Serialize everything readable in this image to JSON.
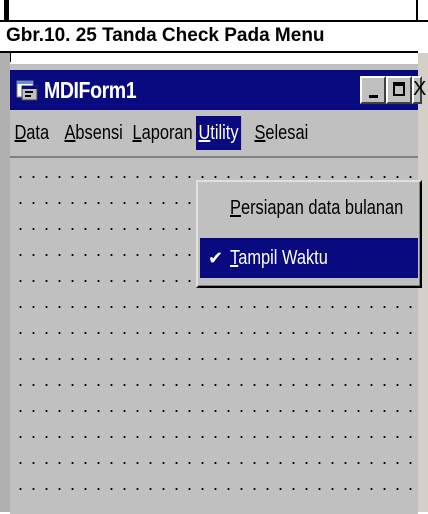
{
  "caption": "Gbr.10. 25 Tanda Check Pada Menu",
  "window": {
    "title": "MDIForm1",
    "app_icon": "form-app-icon",
    "controls": {
      "minimize_icon": "minimize-icon",
      "maximize_icon": "maximize-icon",
      "close_label": "X"
    }
  },
  "menubar": {
    "items": [
      {
        "label": "Data",
        "accel": "D",
        "rest": "ata"
      },
      {
        "label": "Absensi",
        "accel": "A",
        "rest": "bsensi"
      },
      {
        "label": "Laporan",
        "accel": "L",
        "rest": "aporan"
      },
      {
        "label": "Utility",
        "accel": "U",
        "rest": "tility",
        "active": true
      },
      {
        "label": "Selesai",
        "accel": "S",
        "rest": "elesai"
      }
    ]
  },
  "dropdown": {
    "items": [
      {
        "label": "Persiapan data bulanan",
        "accel": "P",
        "rest": "ersiapan data bulanan",
        "checked": false
      },
      {
        "label": "Tampil Waktu",
        "accel": "T",
        "rest": "ampil Waktu",
        "checked": true,
        "check_glyph": "✔"
      }
    ]
  },
  "colors": {
    "titlebar": "#0a0a80",
    "face": "#c0c0c0",
    "highlight": "#0a0a80"
  }
}
